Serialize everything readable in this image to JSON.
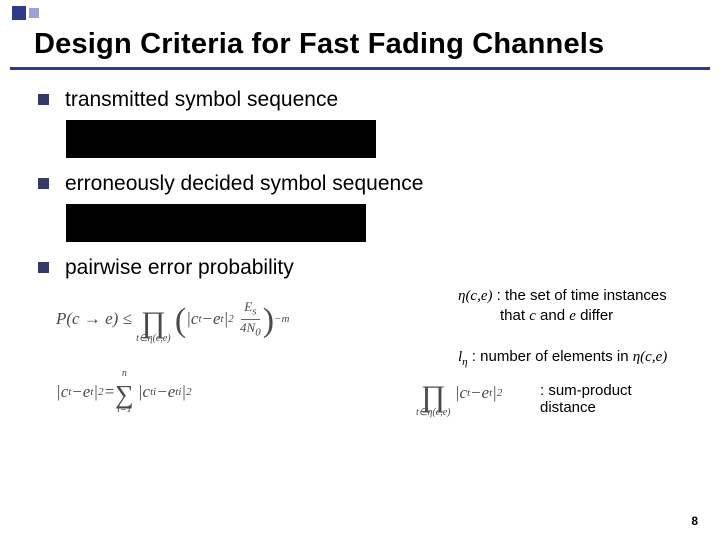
{
  "title": "Design Criteria for Fast Fading Channels",
  "bullets": {
    "b1": "transmitted symbol sequence",
    "b2": "erroneously decided symbol sequence",
    "b3": "pairwise error probability"
  },
  "formulas": {
    "pep_lhs": "P(c → e) ≤",
    "prod_sub": "t∈η(c,e)",
    "ct_et": "c",
    "ct_et2": "e",
    "sq_exp": "2",
    "es": "E",
    "es_sub": "s",
    "fourN0": "4N",
    "n0sub": "0",
    "neg_m": "−m",
    "eta_def1": "η(c,e)",
    "eta_def1_txt": " : the set of time instances",
    "eta_def1_txt2": "that ",
    "eta_c": "c",
    "eta_and": " and ",
    "eta_e": "e",
    "eta_diff": " differ",
    "l_eta": "l",
    "l_eta_sub": "η",
    "l_eta_txt": "   : number of elements in ",
    "l_eta_end": "η(c,e)",
    "norm2_lhs_c": "c",
    "norm2_lhs_e": "e",
    "eq": " = ",
    "sum_top": "n",
    "sum_bot": "i=1",
    "sum_body_c": "c",
    "sum_body_e": "e",
    "note3": " : sum-product distance"
  },
  "page": "8"
}
